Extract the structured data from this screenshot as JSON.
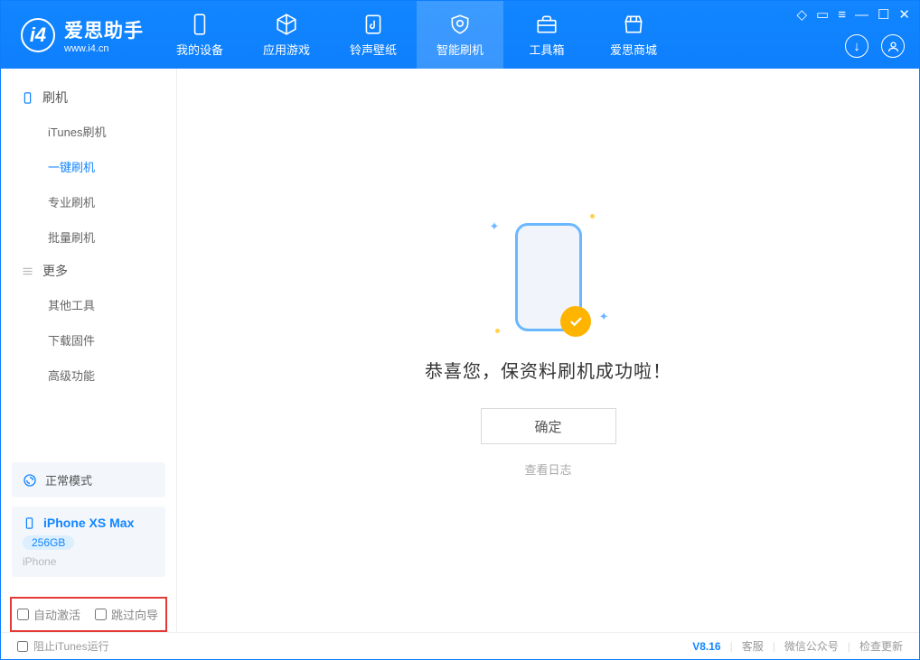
{
  "app": {
    "name_cn": "爱思助手",
    "name_en": "www.i4.cn"
  },
  "nav": {
    "items": [
      {
        "label": "我的设备",
        "icon": "device"
      },
      {
        "label": "应用游戏",
        "icon": "cube"
      },
      {
        "label": "铃声壁纸",
        "icon": "music"
      },
      {
        "label": "智能刷机",
        "icon": "shield",
        "active": true
      },
      {
        "label": "工具箱",
        "icon": "toolbox"
      },
      {
        "label": "爱思商城",
        "icon": "store"
      }
    ]
  },
  "sidebar": {
    "section_flash": "刷机",
    "items_flash": [
      {
        "label": "iTunes刷机"
      },
      {
        "label": "一键刷机",
        "active": true
      },
      {
        "label": "专业刷机"
      },
      {
        "label": "批量刷机"
      }
    ],
    "section_more": "更多",
    "items_more": [
      {
        "label": "其他工具"
      },
      {
        "label": "下载固件"
      },
      {
        "label": "高级功能"
      }
    ]
  },
  "device": {
    "mode_label": "正常模式",
    "name": "iPhone XS Max",
    "storage": "256GB",
    "type": "iPhone"
  },
  "options": {
    "auto_activate": "自动激活",
    "skip_guide": "跳过向导"
  },
  "main": {
    "success_text": "恭喜您，保资料刷机成功啦！",
    "ok_button": "确定",
    "view_log": "查看日志"
  },
  "footer": {
    "block_itunes": "阻止iTunes运行",
    "version": "V8.16",
    "links": [
      "客服",
      "微信公众号",
      "检查更新"
    ]
  }
}
